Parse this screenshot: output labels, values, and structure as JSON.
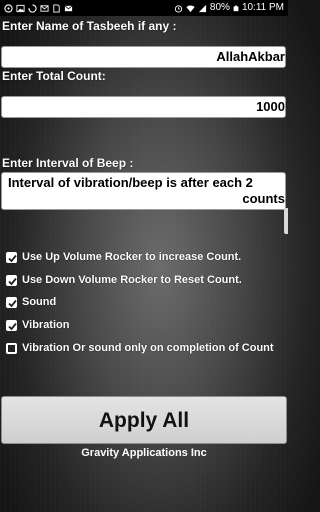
{
  "status_bar": {
    "battery": "80%",
    "time": "10:11 PM",
    "icons": [
      "whatsapp-icon",
      "image-icon",
      "sync-icon",
      "mail-icon",
      "sim-icon",
      "email-icon",
      "alarm-icon",
      "wifi-icon",
      "signal-icon",
      "battery-icon"
    ]
  },
  "form": {
    "name_label": "Enter Name of Tasbeeh if any :",
    "name_value": "AllahAkbar",
    "count_label": "Enter Total Count:",
    "count_value": "1000",
    "interval_label": "Enter Interval of Beep :",
    "interval_line1": "Interval of vibration/beep is after each 2",
    "interval_line2": "counts"
  },
  "options": [
    {
      "label": "Use Up Volume Rocker to increase Count.",
      "checked": true
    },
    {
      "label": "Use Down Volume Rocker to Reset Count.",
      "checked": true
    },
    {
      "label": "Sound",
      "checked": true
    },
    {
      "label": "Vibration",
      "checked": true
    },
    {
      "label": "Vibration Or sound only on completion of Count",
      "checked": false
    }
  ],
  "apply_label": "Apply All",
  "footer": "Gravity Applications Inc"
}
